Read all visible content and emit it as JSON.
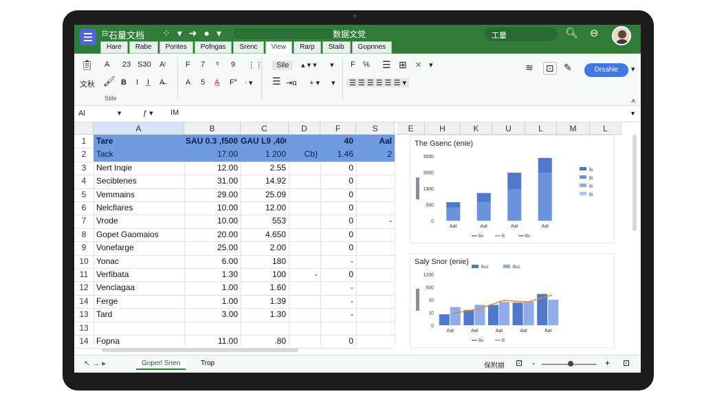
{
  "app": {
    "doc_title": "石量文档",
    "center_title": "数据文党",
    "right_pill": "工量",
    "share_label": "Drsahie"
  },
  "tabs": [
    "Hare",
    "Rabe",
    "Pontes",
    "Pofngas",
    "Srenc",
    "View",
    "Rarp",
    "Staib",
    "Gopnnes"
  ],
  "ribbon": {
    "font_a": "A",
    "size_23": "23",
    "s30": "S30",
    "format_label": "文秋",
    "bold": "B",
    "underline": "I",
    "size_7": "7",
    "size_5": "5",
    "size_9": "9",
    "font_name": "Sile",
    "sub_label": "Stile"
  },
  "formula": {
    "name_box": "Al",
    "fx": "fx",
    "value": "IM"
  },
  "columns": [
    "A",
    "B",
    "C",
    "D",
    "F",
    "S",
    "E",
    "H",
    "K",
    "U",
    "L",
    "M",
    "L"
  ],
  "rows": [
    {
      "n": "1",
      "a": "Tare",
      "b": "SAU 0.3 ,f500",
      "c": "GAU L9 ,400",
      "d": "",
      "f": "40",
      "s": "Aal"
    },
    {
      "n": "2",
      "a": "Tack",
      "b": "17.00",
      "c": "1 200",
      "d": "Cb)",
      "f": "1.46",
      "s": "2"
    },
    {
      "n": "3",
      "a": "Nert Inqie",
      "b": "12.00",
      "c": "2.55",
      "d": "",
      "f": "0",
      "s": ""
    },
    {
      "n": "4",
      "a": "Seciblenes",
      "b": "31.00",
      "c": "14.92",
      "d": "",
      "f": "0",
      "s": ""
    },
    {
      "n": "5",
      "a": "Vemmains",
      "b": "29.00",
      "c": "25.09",
      "d": "",
      "f": "0",
      "s": ""
    },
    {
      "n": "6",
      "a": "Nelcfiares",
      "b": "10.00",
      "c": "12.00",
      "d": "",
      "f": "0",
      "s": ""
    },
    {
      "n": "7",
      "a": "Vrode",
      "b": "10.00",
      "c": "553",
      "d": "",
      "f": "0",
      "s": "-"
    },
    {
      "n": "8",
      "a": "Gopet Gaomaios",
      "b": "20.00",
      "c": "4.650",
      "d": "",
      "f": "0",
      "s": ""
    },
    {
      "n": "9",
      "a": "Vonefarge",
      "b": "25.00",
      "c": "2.00",
      "d": "",
      "f": "0",
      "s": ""
    },
    {
      "n": "10",
      "a": "Yonac",
      "b": "6.00",
      "c": "180",
      "d": "",
      "f": "-",
      "s": ""
    },
    {
      "n": "11",
      "a": "Verfibata",
      "b": "1.30",
      "c": "100",
      "d": "-",
      "f": "0",
      "s": ""
    },
    {
      "n": "12",
      "a": "Venclagaa",
      "b": "1.00",
      "c": "1.60",
      "d": "",
      "f": "-",
      "s": ""
    },
    {
      "n": "14",
      "a": "Ferge",
      "b": "1.00",
      "c": "1.39",
      "d": "",
      "f": "-",
      "s": ""
    },
    {
      "n": "13",
      "a": "Tard",
      "b": "3.00",
      "c": "1.30",
      "d": "",
      "f": "-",
      "s": ""
    },
    {
      "n": "13",
      "a": "",
      "b": "",
      "c": "",
      "d": "",
      "f": "",
      "s": ""
    },
    {
      "n": "14",
      "a": "Fopna",
      "b": "11.00",
      "c": ".80",
      "d": "",
      "f": "0",
      "s": ""
    }
  ],
  "chart_data": [
    {
      "type": "bar",
      "title": "The Gsenc (enie)",
      "categories": [
        "Aat",
        "Aat",
        "Aat",
        "Aat"
      ],
      "yticks": [
        "3500",
        "3000",
        "1500",
        "500",
        "0"
      ],
      "ylim": [
        0,
        3500
      ],
      "series": [
        {
          "values": [
            700,
            1000,
            1700,
            2600
          ],
          "color": "#6b93dc"
        },
        {
          "values": [
            300,
            500,
            900,
            800
          ],
          "color": "#4e78cc"
        }
      ],
      "legend": [
        "Bi",
        "Bi",
        "Bi",
        "Bi"
      ],
      "legend_colors": [
        "#4e78cc",
        "#6b93dc",
        "#8eacea",
        "#aec3ef"
      ],
      "x_legend": [
        "Bo",
        "B",
        "Bo"
      ]
    },
    {
      "type": "bar",
      "title": "Saly Snor (enie)",
      "categories": [
        "Aat",
        "Aat",
        "Aat",
        "Aat",
        "Aat"
      ],
      "yticks": [
        "1200",
        "500",
        "10",
        "10",
        "0"
      ],
      "ylim": [
        0,
        1400
      ],
      "series": [
        {
          "name": "Bo1",
          "values": [
            300,
            420,
            560,
            620,
            860
          ],
          "color": "#4e78cc"
        },
        {
          "name": "Bo1",
          "values": [
            500,
            560,
            640,
            650,
            700
          ],
          "color": "#8eacea"
        }
      ],
      "line": {
        "values": [
          330,
          450,
          680,
          640,
          830
        ],
        "color": "#e0892a"
      },
      "legend": [
        "Bo1",
        "Bo1"
      ],
      "x_legend": [
        "Bo",
        "B"
      ]
    }
  ],
  "status": {
    "sheet_active": "Goperl Srien",
    "sheet_other": "Trop",
    "status_text": "保附崩"
  }
}
